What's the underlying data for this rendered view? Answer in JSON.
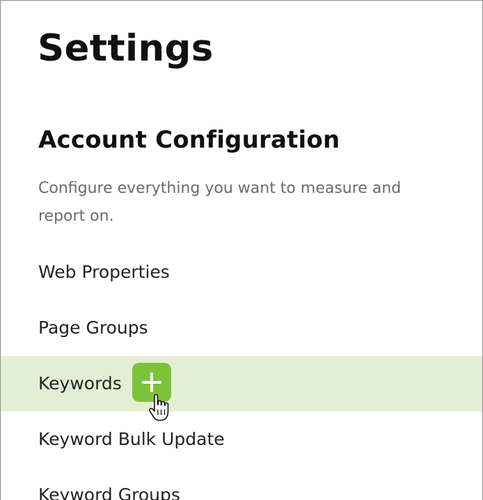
{
  "page": {
    "title": "Settings"
  },
  "section": {
    "title": "Account Configuration",
    "description": "Configure everything you want to measure and report on."
  },
  "nav": {
    "items": [
      {
        "label": "Web Properties",
        "active": false
      },
      {
        "label": "Page Groups",
        "active": false
      },
      {
        "label": "Keywords",
        "active": true,
        "has_add_button": true
      },
      {
        "label": "Keyword Bulk Update",
        "active": false
      },
      {
        "label": "Keyword Groups",
        "active": false
      }
    ]
  },
  "icons": {
    "add": "plus-icon",
    "cursor": "hand-pointer-icon"
  },
  "colors": {
    "active_row_bg": "#e3efd4",
    "add_button_bg": "#7cc23a",
    "title_text": "#111111",
    "desc_text": "#6b6b6b"
  }
}
